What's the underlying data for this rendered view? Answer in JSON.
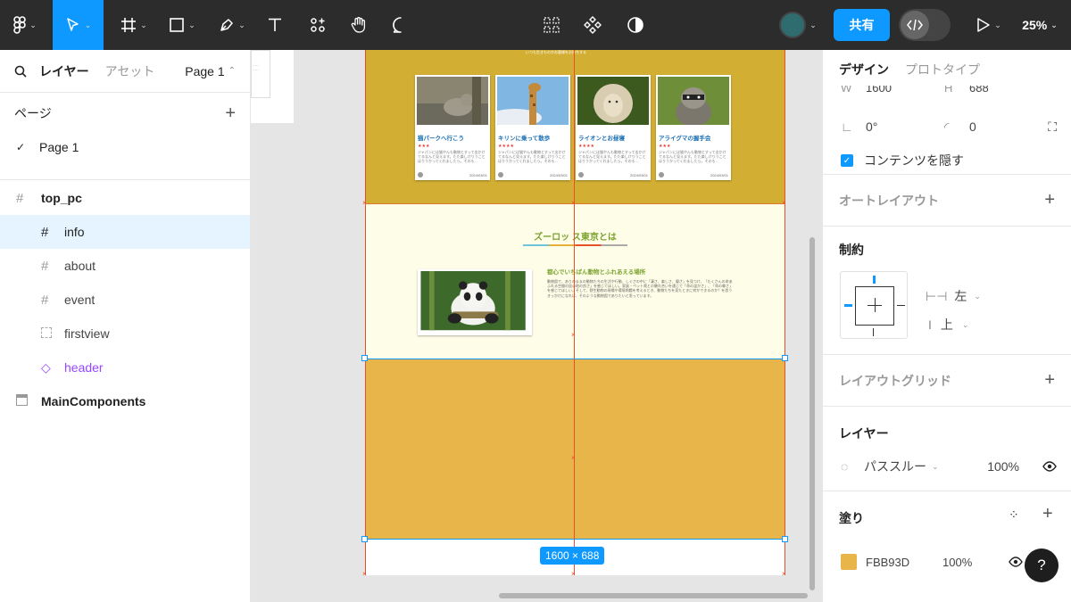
{
  "toolbar": {
    "share_label": "共有",
    "zoom": "25%",
    "icons": [
      "figma-menu-icon",
      "move-icon",
      "frame-icon",
      "rectangle-icon",
      "pen-icon",
      "text-icon",
      "resources-icon",
      "hand-icon",
      "comment-icon",
      "component-grid-icon",
      "component-icon",
      "contrast-icon",
      "avatar",
      "dev-mode-icon",
      "play-icon"
    ]
  },
  "left_panel": {
    "tabs": {
      "layers": "レイヤー",
      "assets": "アセット",
      "page_selector": "Page 1"
    },
    "pages_heading": "ページ",
    "current_page": "Page 1",
    "layers": [
      {
        "name": "top_pc"
      },
      {
        "name": "info"
      },
      {
        "name": "about"
      },
      {
        "name": "event"
      },
      {
        "name": "firstview"
      },
      {
        "name": "header"
      },
      {
        "name": "MainComponents"
      }
    ]
  },
  "canvas": {
    "size_badge": "1600 × 688",
    "cards": [
      {
        "title": "猫パークへ行こう",
        "stars": "★★★",
        "text": "ジャパンには猫やんも動物とすって出かけてるなんと見えます。たた楽しけりうことはりうかってくれましたら。そのも...",
        "date": "2024/03/01"
      },
      {
        "title": "キリンに乗って散歩",
        "stars": "★★★★",
        "text": "ジャパンには猫やんも動物とすって出かけてるなんと見えます。たた楽しけりうことはりうかってくれましたら。そのも...",
        "date": "2024/03/01"
      },
      {
        "title": "ライオンとお昼寝",
        "stars": "★★★★",
        "text": "ジャパンには猫やんも動物とすって出かけてるなんと見えます。たた楽しけりうことはりうかってくれましたら。そのも...",
        "date": "2024/03/01"
      },
      {
        "title": "アライグマの握手会",
        "stars": "★★★",
        "text": "ジャパンには猫やんも動物とすって出かけてるなんと見えます。たた楽しけりうことはりうかってくれましたら。そのも...",
        "date": "2024/03/01"
      }
    ],
    "about_heading": "ズーロッ ス東京とは",
    "about_subheading": "都心でいちばん動物とふれあえる場所",
    "about_body": "動物園で、ありのままの動物たちの生活や行動、しぐさの中に「凄さ、楽しさ、優さ」を見つけ、「たくさんの命あふれる空間の居心地の良さ」を感じてほしい。家族・ペット哉との触れ合いを通じて「命の温かさ」、「命の尊さ」を感じてほしい。そして、野生動物の現場や環境問題を考えるとき、動物たちを見たときに何かできるのか？を思うきっかけになれば、そのような動物園でありたいと思っています。",
    "top_caption": "いつも生きものかお客様をお持ちする"
  },
  "right_panel": {
    "tabs": {
      "design": "デザイン",
      "prototype": "プロトタイプ"
    },
    "w_label": "W",
    "w_value": "1600",
    "h_label": "H",
    "h_value": "688",
    "rotation": "0°",
    "radius": "0",
    "clip_content": "コンテンツを隠す",
    "auto_layout": "オートレイアウト",
    "constraints": "制約",
    "constraint_h": "左",
    "constraint_v": "上",
    "layout_grid": "レイアウトグリッド",
    "layer_heading": "レイヤー",
    "blend_mode": "パススルー",
    "opacity": "100%",
    "fill_heading": "塗り",
    "fill_hex": "FBB93D",
    "fill_opacity": "100%",
    "help": "?"
  },
  "colors": {
    "toolbar_bg": "#2c2c2c",
    "accent": "#0d99ff",
    "guide": "#e8502a",
    "fill_swatch": "#e8b54a",
    "hero_bg": "#d2ae33",
    "about_bg": "#fefde8"
  }
}
